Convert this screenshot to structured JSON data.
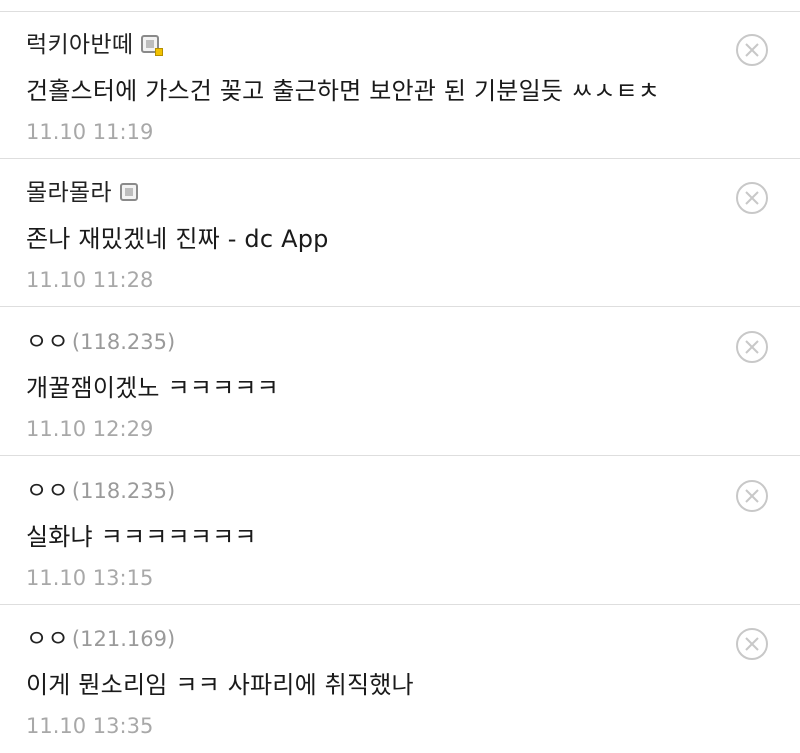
{
  "comments": [
    {
      "author": "럭키아반떼",
      "ip": "",
      "content": "건홀스터에 가스건 꽂고 출근하면 보안관 된 기분일듯 ㅆㅅㅌㅊ",
      "time": "11.10 11:19",
      "icon": "member-badge-icon"
    },
    {
      "author": "몰라몰라",
      "ip": "",
      "content": "존나 재밌겠네 진짜 - dc App",
      "time": "11.10 11:28",
      "icon": "member-badge-icon"
    },
    {
      "author": "ㅇㅇ",
      "ip": "(118.235)",
      "content": "개꿀잼이겠노 ㅋㅋㅋㅋㅋ",
      "time": "11.10 12:29"
    },
    {
      "author": "ㅇㅇ",
      "ip": "(118.235)",
      "content": "실화냐 ㅋㅋㅋㅋㅋㅋㅋ",
      "time": "11.10 13:15"
    },
    {
      "author": "ㅇㅇ",
      "ip": "(121.169)",
      "content": "이게 뭔소리임 ㅋㅋ 사파리에 취직했나",
      "time": "11.10 13:35"
    }
  ],
  "colors": {
    "divider": "#dedede",
    "time_text": "#a8a8a8",
    "ip_text": "#9a9a9a",
    "delete_icon": "#c8c8c8"
  }
}
